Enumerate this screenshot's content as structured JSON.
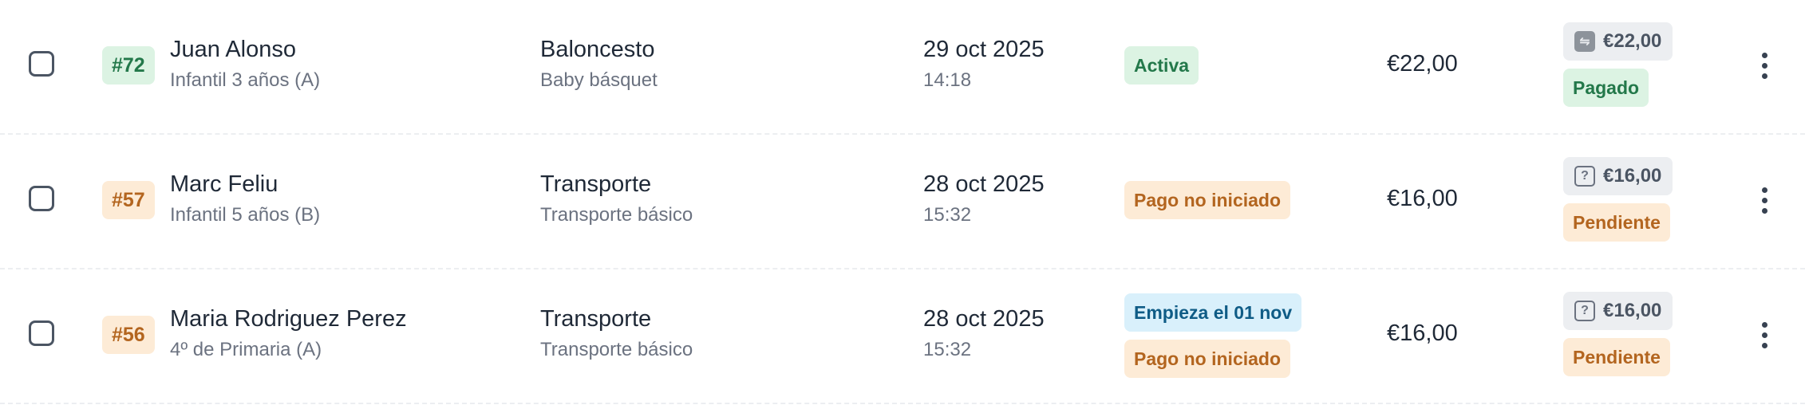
{
  "rows": [
    {
      "id": "#72",
      "id_color": "green",
      "name": "Juan Alonso",
      "group": "Infantil 3 años (A)",
      "activity": "Baloncesto",
      "subactivity": "Baby básquet",
      "date": "29 oct 2025",
      "time": "14:18",
      "statuses": [
        {
          "label": "Activa",
          "color": "green"
        }
      ],
      "amount": "€22,00",
      "payment_amount": "€22,00",
      "payment_icon": "transfer-icon",
      "payment_status": "Pagado",
      "payment_status_color": "green"
    },
    {
      "id": "#57",
      "id_color": "orange",
      "name": "Marc Feliu",
      "group": "Infantil 5 años (B)",
      "activity": "Transporte",
      "subactivity": "Transporte básico",
      "date": "28 oct 2025",
      "time": "15:32",
      "statuses": [
        {
          "label": "Pago no iniciado",
          "color": "orange"
        }
      ],
      "amount": "€16,00",
      "payment_amount": "€16,00",
      "payment_icon": "question-icon",
      "payment_status": "Pendiente",
      "payment_status_color": "orange"
    },
    {
      "id": "#56",
      "id_color": "orange",
      "name": "Maria Rodriguez Perez",
      "group": "4º de Primaria (A)",
      "activity": "Transporte",
      "subactivity": "Transporte básico",
      "date": "28 oct 2025",
      "time": "15:32",
      "statuses": [
        {
          "label": "Empieza el 01 nov",
          "color": "blue"
        },
        {
          "label": "Pago no iniciado",
          "color": "orange"
        }
      ],
      "amount": "€16,00",
      "payment_amount": "€16,00",
      "payment_icon": "question-icon",
      "payment_status": "Pendiente",
      "payment_status_color": "orange"
    }
  ]
}
